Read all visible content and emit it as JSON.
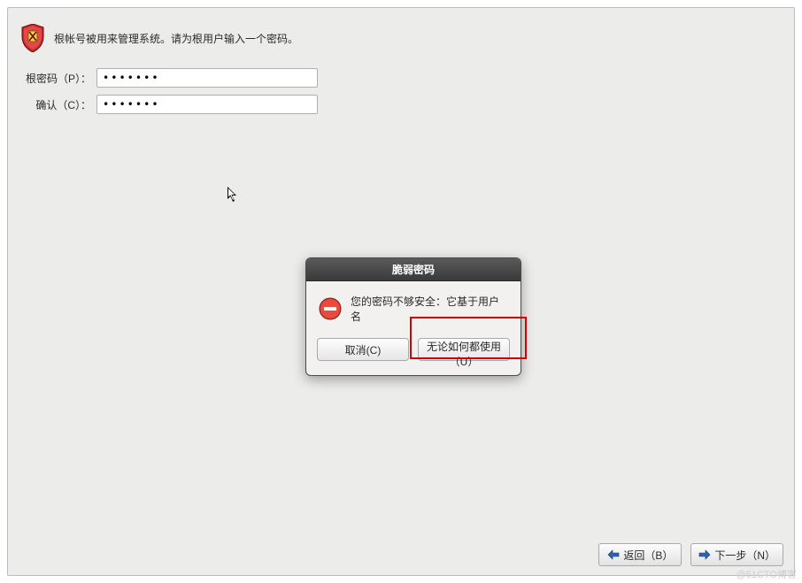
{
  "header": {
    "instruction": "根帐号被用来管理系统。请为根用户输入一个密码。"
  },
  "form": {
    "root_password_label": "根密码（P）：",
    "root_password_value": "•••••••",
    "confirm_label": "确认（C）：",
    "confirm_value": "•••••••"
  },
  "dialog": {
    "title": "脆弱密码",
    "message": "您的密码不够安全：它基于用户名",
    "cancel_label": "取消(C)",
    "use_anyway_label": "无论如何都使用（U）"
  },
  "footer": {
    "back_label": "返回（B）",
    "next_label": "下一步（N）"
  },
  "watermark": "@51CTO博客"
}
